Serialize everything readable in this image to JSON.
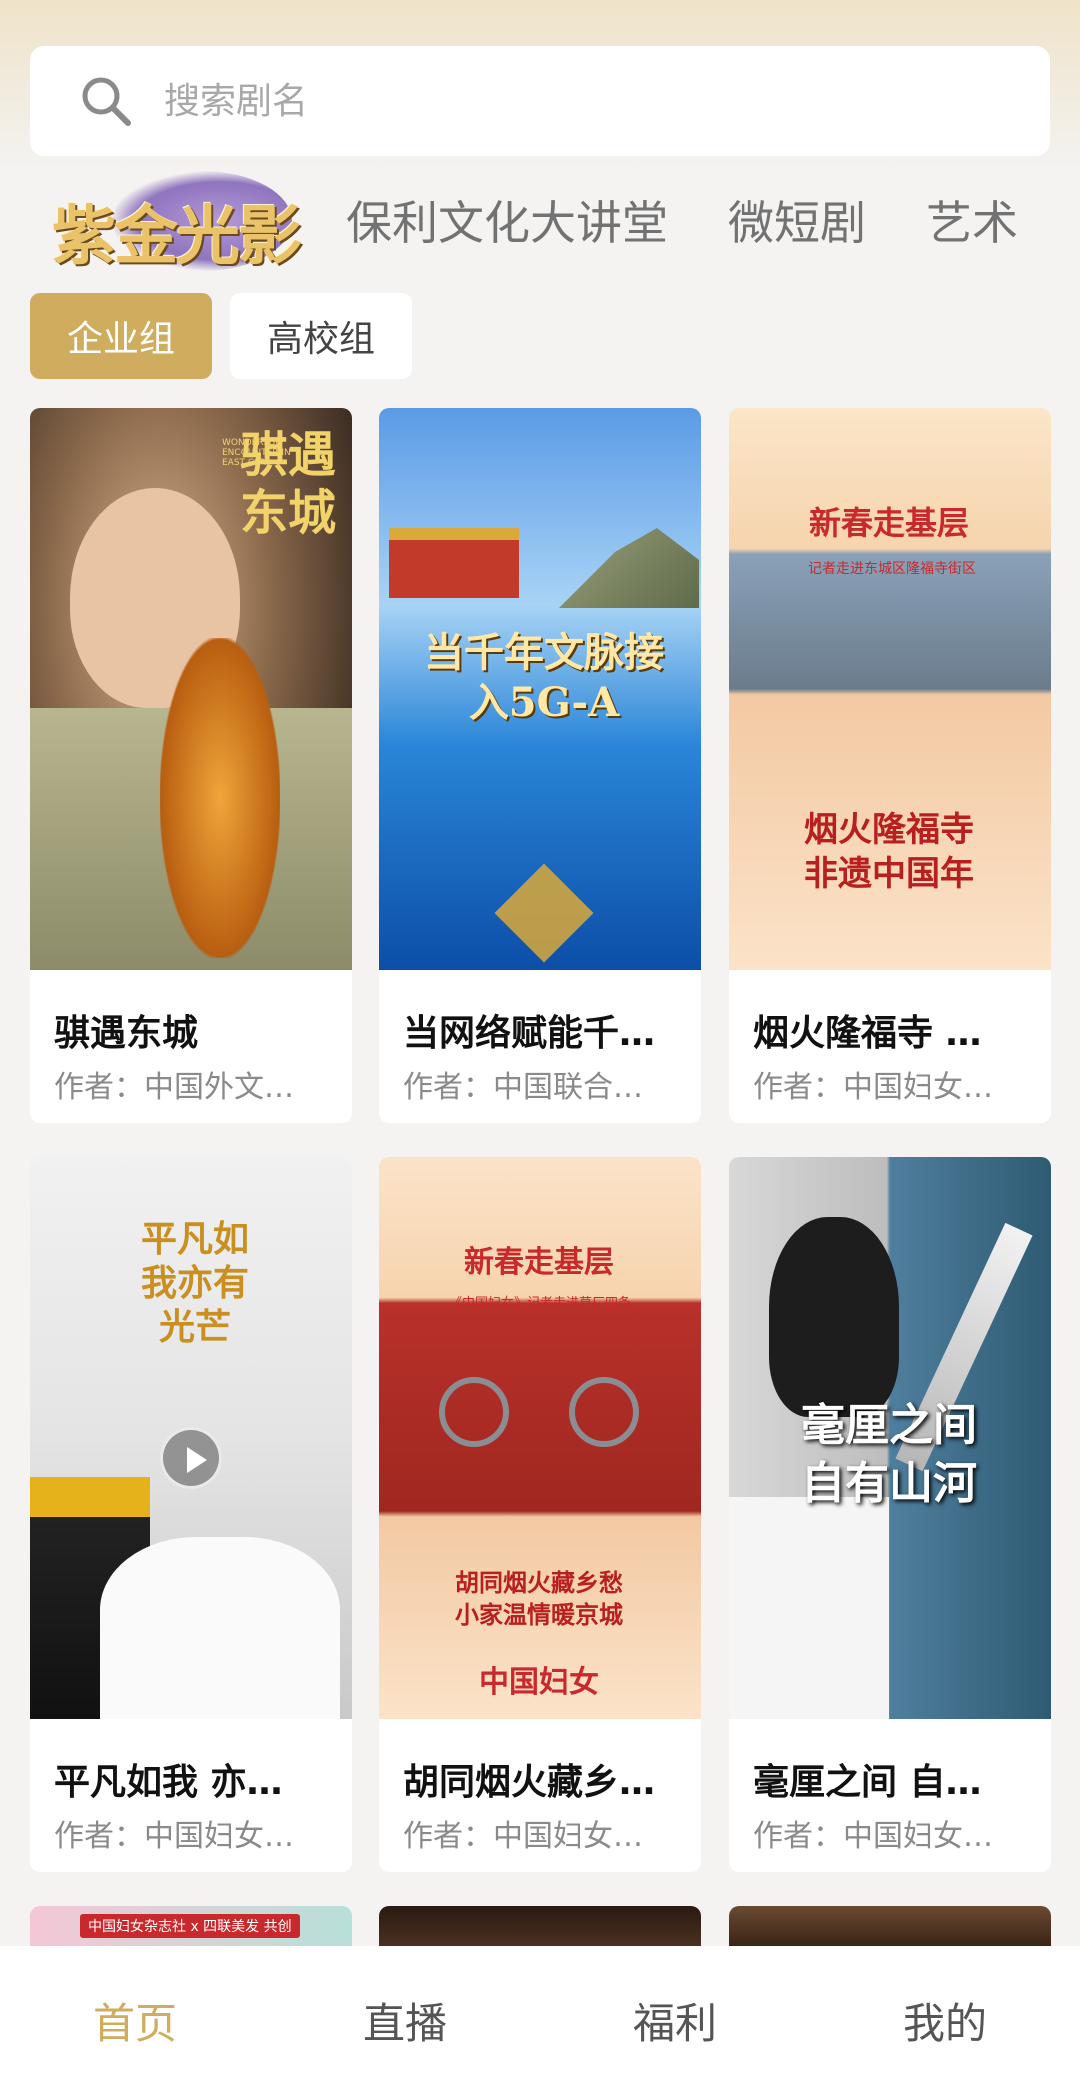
{
  "search": {
    "placeholder": "搜索剧名"
  },
  "categories": {
    "logo_text": "紫金光影",
    "items": [
      "保利文化大讲堂",
      "微短剧",
      "艺术"
    ]
  },
  "groups": {
    "active": "企业组",
    "inactive": "高校组"
  },
  "cards": [
    {
      "title": "骐遇东城",
      "author": "作者：中国外文…",
      "poster_text": "骐遇东城",
      "poster_sub": "WONDERFUL ENCOUNTER IN EAST CITY"
    },
    {
      "title": "当网络赋能千…",
      "author": "作者：中国联合…",
      "poster_text": "当千年文脉接入5G-A"
    },
    {
      "title": "烟火隆福寺 …",
      "author": "作者：中国妇女…",
      "poster_top": "新春走基层",
      "poster_sub": "记者走进东城区隆福寺街区",
      "poster_bottom": "烟火隆福寺非遗中国年"
    },
    {
      "title": "平凡如我 亦…",
      "author": "作者：中国妇女…",
      "poster_text": "平凡如我亦有光芒"
    },
    {
      "title": "胡同烟火藏乡…",
      "author": "作者：中国妇女…",
      "poster_top": "新春走基层",
      "poster_sub": "《中国妇女》记者走进草厂四条",
      "poster_bottom": "胡同烟火藏乡愁小家温情暖京城",
      "poster_brand": "中国妇女"
    },
    {
      "title": "毫厘之间 自…",
      "author": "作者：中国妇女…",
      "poster_text": "毫厘之间自有山河"
    }
  ],
  "partial_row": {
    "label": "中国妇女杂志社 x 四联美发 共创"
  },
  "nav": {
    "home": "首页",
    "live": "直播",
    "welfare": "福利",
    "mine": "我的"
  },
  "colors": {
    "accent": "#cfac5e",
    "background": "#f4f3f1"
  }
}
